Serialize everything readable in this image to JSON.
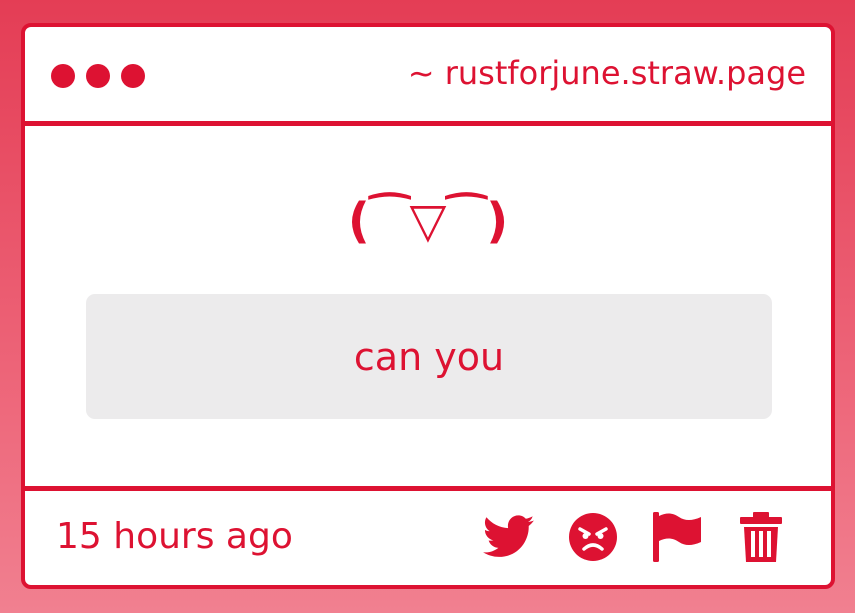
{
  "window": {
    "url": "~ rustforjune.straw.page",
    "accent_color": "#dd1232"
  },
  "main": {
    "emoticon": "(⁀▽⁀)",
    "message": "can you"
  },
  "footer": {
    "timestamp": "15 hours ago",
    "actions": [
      "twitter-icon",
      "angry-face-icon",
      "flag-icon",
      "trash-icon"
    ]
  }
}
